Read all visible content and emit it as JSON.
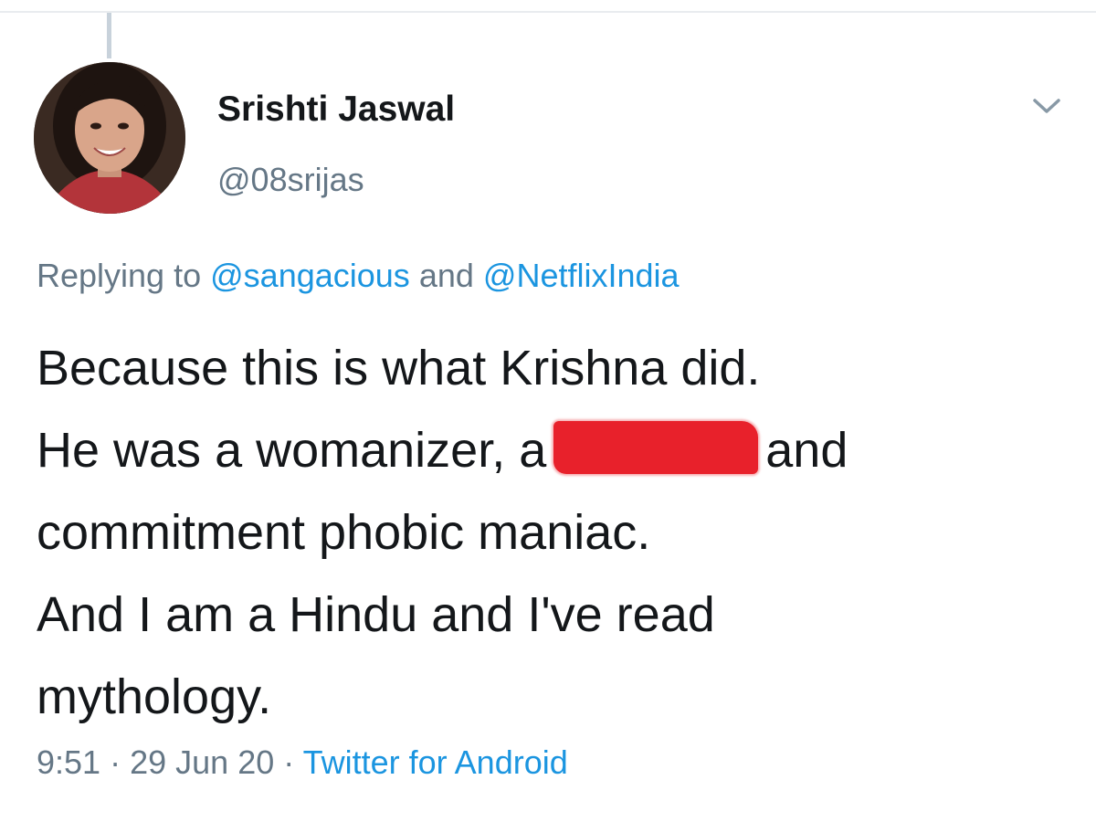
{
  "tweet": {
    "author": {
      "display_name": "Srishti Jaswal",
      "handle": "@08srijas"
    },
    "replying": {
      "prefix": "Replying to",
      "mention_1": "@sangacious",
      "conjunction": "and",
      "mention_2": "@NetflixIndia"
    },
    "body": {
      "line_1": "Because this is what Krishna did.",
      "line_2_before": "He was a womanizer, a",
      "line_2_after": "and",
      "line_3": "commitment phobic maniac.",
      "line_4": "And I am a Hindu and I've read",
      "line_5": "mythology."
    },
    "meta": {
      "time": "9:51",
      "separator": "·",
      "date": "29 Jun 20",
      "source": "Twitter for Android"
    }
  },
  "colors": {
    "text_primary": "#14171a",
    "text_secondary": "#657786",
    "link": "#1b95e0",
    "redaction": "#e8212b"
  },
  "icons": {
    "more": "chevron-down-icon"
  }
}
